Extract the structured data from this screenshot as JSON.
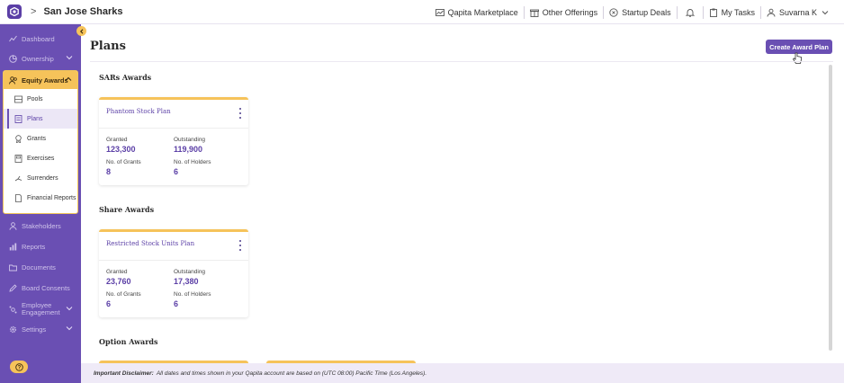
{
  "header": {
    "company": "San Jose Sharks",
    "marketplace": "Qapita Marketplace",
    "other_offerings": "Other Offerings",
    "startup_deals": "Startup Deals",
    "my_tasks": "My Tasks",
    "user": "Suvarna K"
  },
  "sidebar": {
    "items": [
      {
        "label": "Dashboard",
        "icon": "dashboard-icon"
      },
      {
        "label": "Ownership",
        "icon": "pie-chart-icon"
      },
      {
        "label": "Equity Awards",
        "icon": "users-icon"
      },
      {
        "label": "Stakeholders",
        "icon": "person-icon"
      },
      {
        "label": "Reports",
        "icon": "bar-chart-icon"
      },
      {
        "label": "Documents",
        "icon": "folder-icon"
      },
      {
        "label": "Board Consents",
        "icon": "pen-icon"
      },
      {
        "label": "Employee",
        "label2": "Engagement",
        "icon": "engagement-icon"
      },
      {
        "label": "Settings",
        "icon": "gear-icon"
      }
    ],
    "equity_sub": [
      {
        "label": "Pools",
        "icon": "pool-icon"
      },
      {
        "label": "Plans",
        "icon": "plan-icon"
      },
      {
        "label": "Grants",
        "icon": "grant-icon"
      },
      {
        "label": "Exercises",
        "icon": "exercise-icon"
      },
      {
        "label": "Surrenders",
        "icon": "surrender-icon"
      },
      {
        "label": "Financial Reports",
        "icon": "report-icon"
      }
    ],
    "active_sub": "Plans"
  },
  "main": {
    "title": "Plans",
    "create_button": "Create Award Plan",
    "sections": [
      {
        "title": "SARs Awards",
        "cards": [
          {
            "name": "Phantom Stock Plan",
            "granted_label": "Granted",
            "granted": "123,300",
            "outstanding_label": "Outstanding",
            "outstanding": "119,900",
            "grants_label": "No. of Grants",
            "grants": "8",
            "holders_label": "No. of Holders",
            "holders": "6"
          }
        ]
      },
      {
        "title": "Share Awards",
        "cards": [
          {
            "name": "Restricted Stock Units Plan",
            "granted_label": "Granted",
            "granted": "23,760",
            "outstanding_label": "Outstanding",
            "outstanding": "17,380",
            "grants_label": "No. of Grants",
            "grants": "6",
            "holders_label": "No. of Holders",
            "holders": "6"
          }
        ]
      },
      {
        "title": "Option Awards",
        "cards": []
      }
    ]
  },
  "disclaimer": {
    "label": "Important Disclaimer:",
    "text": "All dates and times shown in your Qapita account are based on (UTC 08:00) Pacific Time (Los Angeles)."
  },
  "colors": {
    "brand_purple": "#6a4fb3",
    "accent_yellow": "#f6c35a"
  }
}
